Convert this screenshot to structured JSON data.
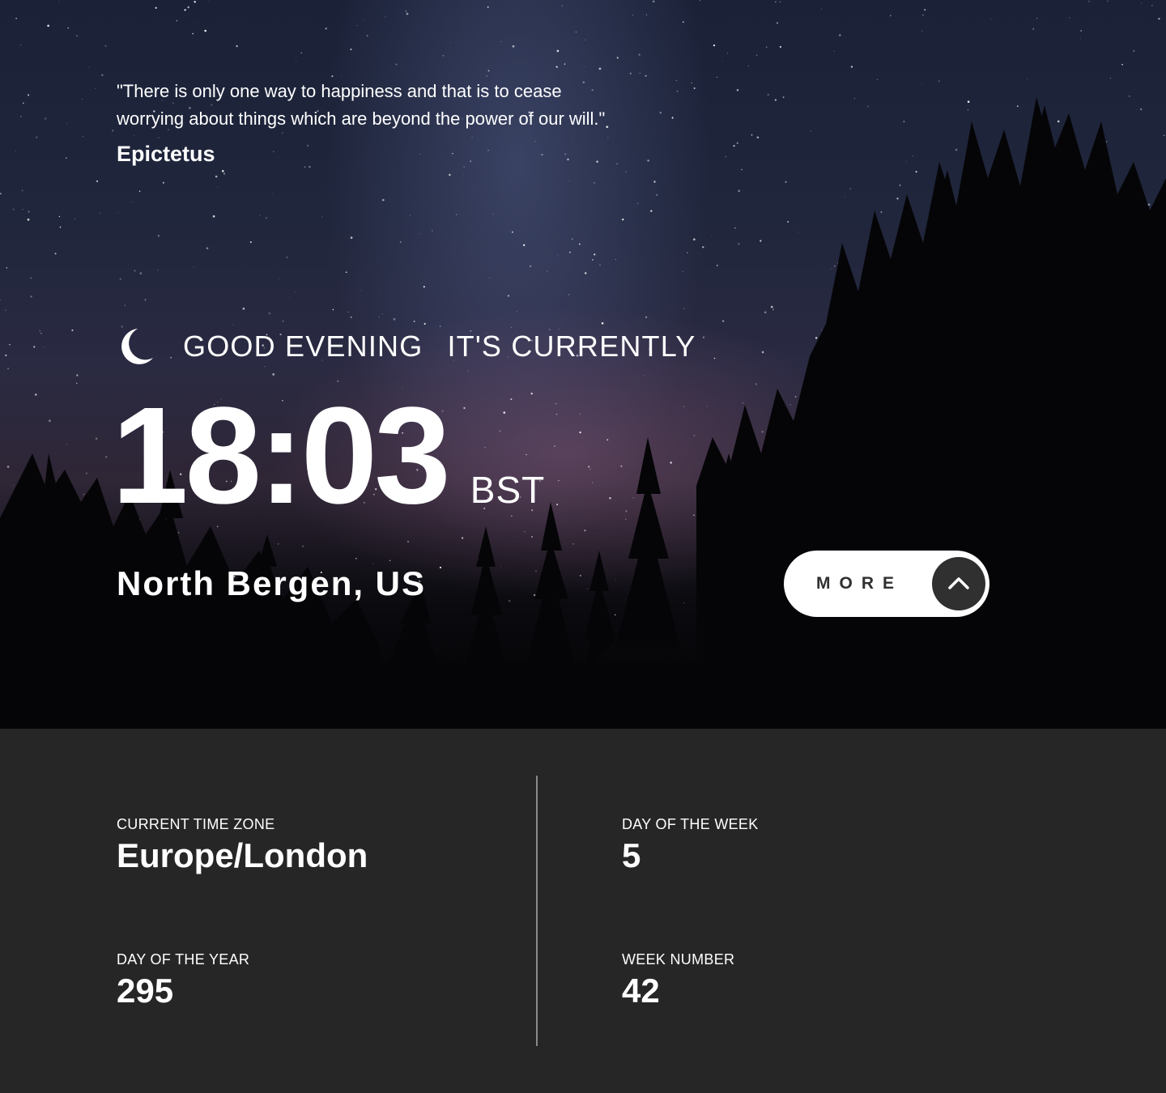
{
  "quote": {
    "text": "\"There is only one way to happiness and that is to cease worrying about things which are beyond the power of our will.\"",
    "author": "Epictetus"
  },
  "clock": {
    "icon": "moon-icon",
    "greeting": "GOOD EVENING",
    "currently": "IT'S CURRENTLY",
    "time": "18:03",
    "timezone_abbr": "BST",
    "location": "North Bergen, US"
  },
  "more_button": {
    "label": "MORE",
    "icon": "chevron-up-icon"
  },
  "details": {
    "timezone": {
      "label": "CURRENT TIME ZONE",
      "value": "Europe/London"
    },
    "day_of_week": {
      "label": "DAY OF THE WEEK",
      "value": "5"
    },
    "day_of_year": {
      "label": "DAY OF THE YEAR",
      "value": "295"
    },
    "week_number": {
      "label": "WEEK NUMBER",
      "value": "42"
    }
  },
  "colors": {
    "panel_background": "#262626",
    "button_background": "#ffffff",
    "button_circle": "#303030",
    "text": "#ffffff"
  }
}
